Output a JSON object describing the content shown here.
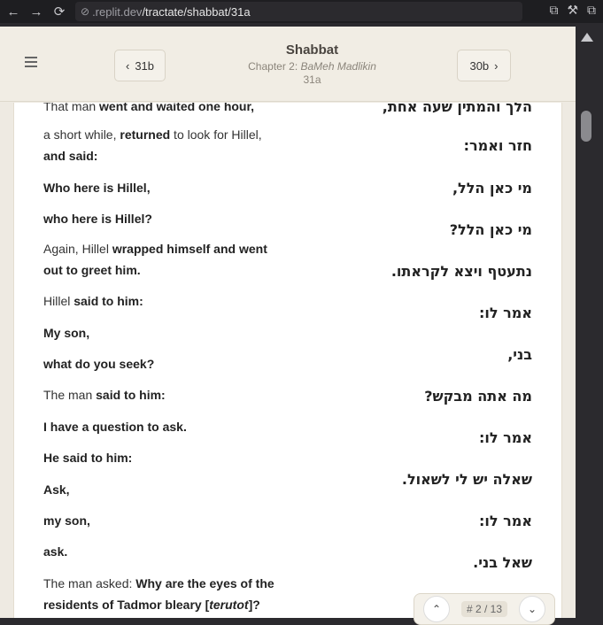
{
  "browser": {
    "back_icon": "←",
    "forward_icon": "→",
    "reload_icon": "⟳",
    "url_icon": "⊘",
    "url_dim": ".replit.dev",
    "url_path": "/tractate/shabbat/31a",
    "icons": [
      "⧉",
      "⚒",
      "⧉"
    ]
  },
  "header": {
    "prev_label": "31b",
    "next_label": "30b",
    "title": "Shabbat",
    "chapter_prefix": "Chapter 2: ",
    "chapter_name": "BaMeh Madlikin",
    "daf": "31a"
  },
  "rows": [
    {
      "en_html": "That man <b>went and waited one hour,</b>",
      "he": "הלך והמתין שעה אחת,"
    },
    {
      "en_html": "a short while, <b>returned</b> to look for Hillel, <b>and said:</b>",
      "he": "חזר ואמר:"
    },
    {
      "en_html": "<b>Who here is Hillel,</b>",
      "he": "מי כאן הלל,"
    },
    {
      "en_html": "<b>who here is Hillel?</b>",
      "he": "מי כאן הלל?"
    },
    {
      "en_html": "Again, Hillel <b>wrapped himself and went out to greet him.</b>",
      "he": "נתעטף ויצא לקראתו."
    },
    {
      "en_html": "Hillel <b>said to him:</b>",
      "he": "אמר לו:"
    },
    {
      "en_html": "<b>My son,</b>",
      "he": "בני,"
    },
    {
      "en_html": "<b>what do you seek?</b>",
      "he": "מה אתה מבקש?"
    },
    {
      "en_html": "The man <b>said to him:</b>",
      "he": "אמר לו:"
    },
    {
      "en_html": "<b>I have a question to ask.</b>",
      "he": "שאלה יש לי לשאול."
    },
    {
      "en_html": "<b>He said to him:</b>",
      "he": "אמר לו:"
    },
    {
      "en_html": "<b>Ask,</b>",
      "he": "שאל בני."
    },
    {
      "en_html": "<b>my son,</b>",
      "he": ""
    },
    {
      "en_html": "<b>ask.</b>",
      "he": ""
    },
    {
      "en_html": "The man asked: <b>Why are the eyes of the residents of Tadmor bleary [<i>terutot</i>]?</b>",
      "he": ""
    }
  ],
  "pager": {
    "up_icon": "⌃",
    "down_icon": "⌄",
    "label": "# 2 / 13"
  }
}
